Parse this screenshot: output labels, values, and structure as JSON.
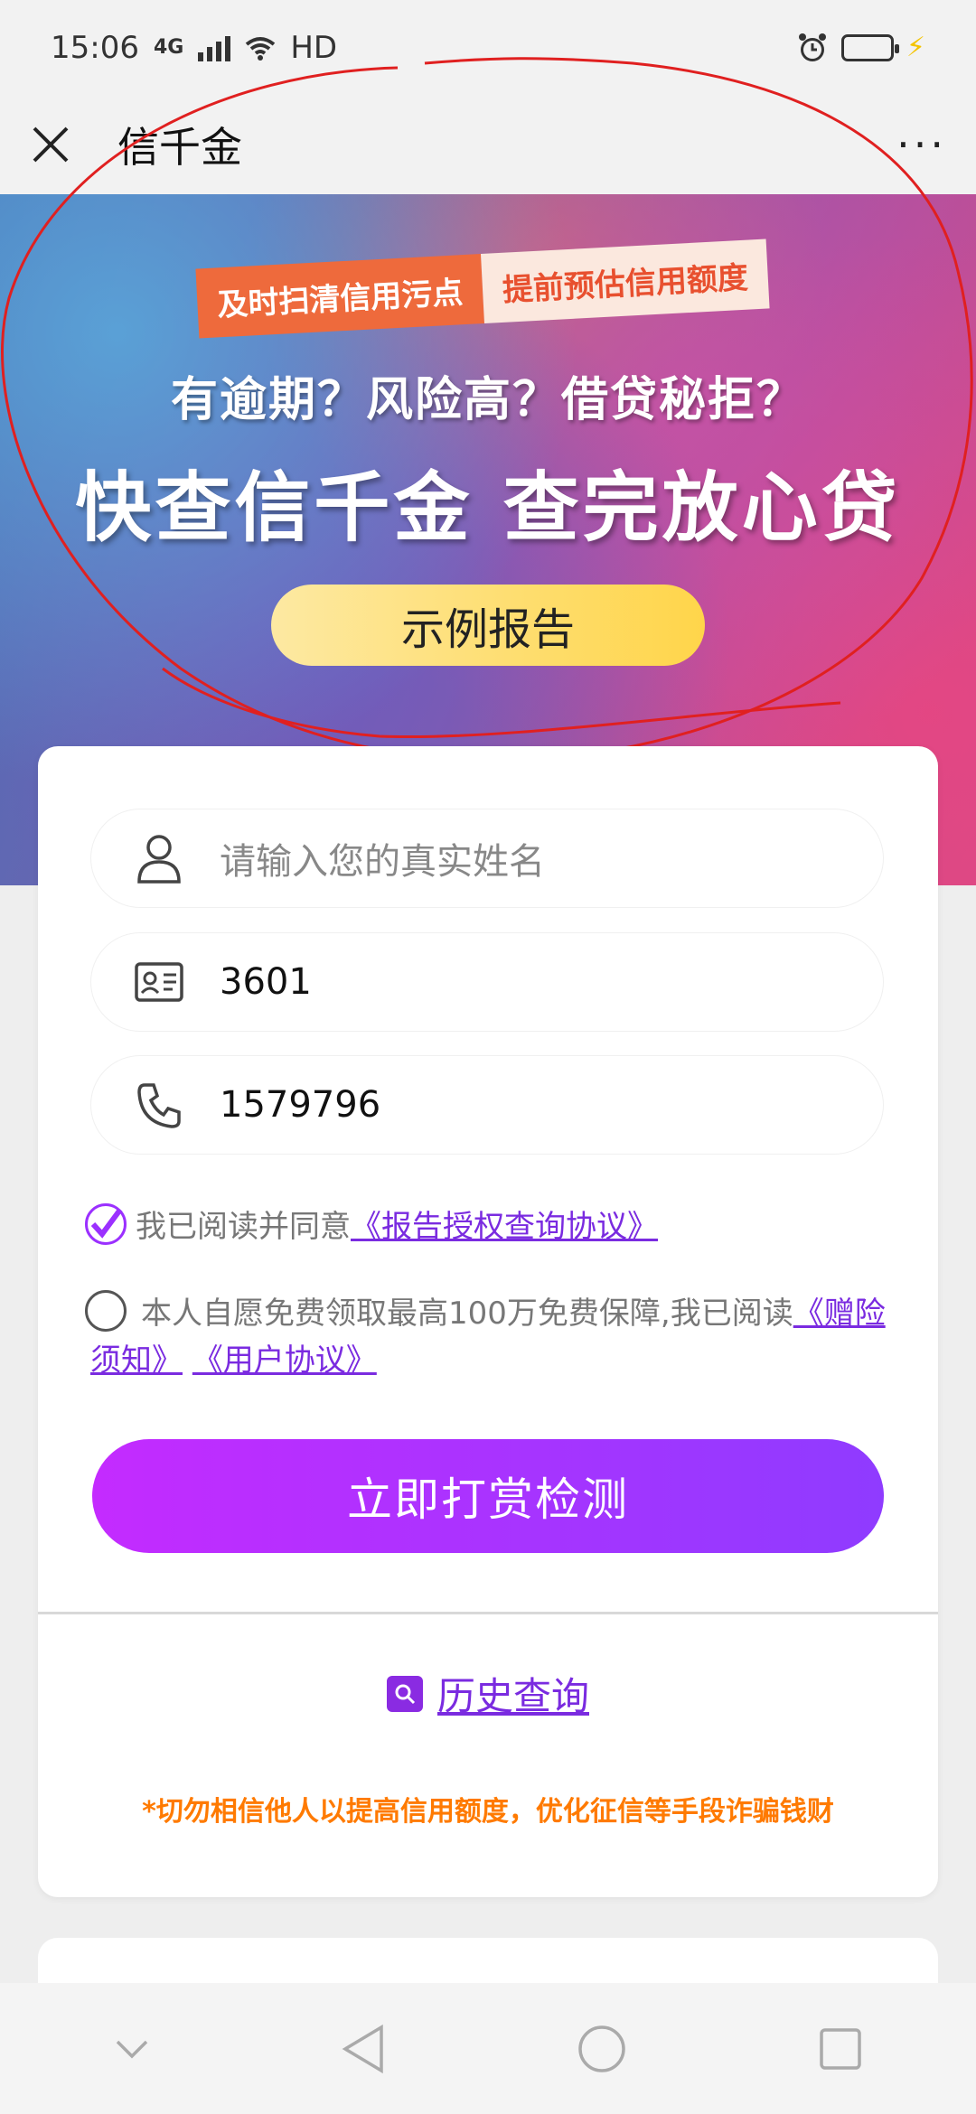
{
  "status_bar": {
    "time": "15:06",
    "network": "4G",
    "hd": "HD"
  },
  "nav": {
    "title": "信千金",
    "more": "···"
  },
  "banner": {
    "tag_left": "及时扫清信用污点",
    "tag_right": "提前预估信用额度",
    "headline_1": "有逾期？风险高？借贷秘拒？",
    "headline_2": "快查信千金  查完放心贷",
    "sample_button": "示例报告"
  },
  "form": {
    "name_placeholder": "请输入您的真实姓名",
    "id_value": "3601",
    "phone_value": "1579796"
  },
  "agreement": {
    "read_text": "我已阅读并同意",
    "read_link": "《报告授权查询协议》",
    "insurance_text": "本人自愿免费领取最高100万免费保障,我已阅读",
    "insurance_link_1": "《赠险须知》",
    "insurance_link_2": "《用户协议》"
  },
  "submit_button": "立即打赏检测",
  "history_link": "历史查询",
  "warning": "*切勿相信他人以提高信用额度，优化征信等手段诈骗钱财",
  "colors": {
    "accent": "#8f3bff",
    "warning": "#ff7a00",
    "link": "#7a2be0"
  }
}
